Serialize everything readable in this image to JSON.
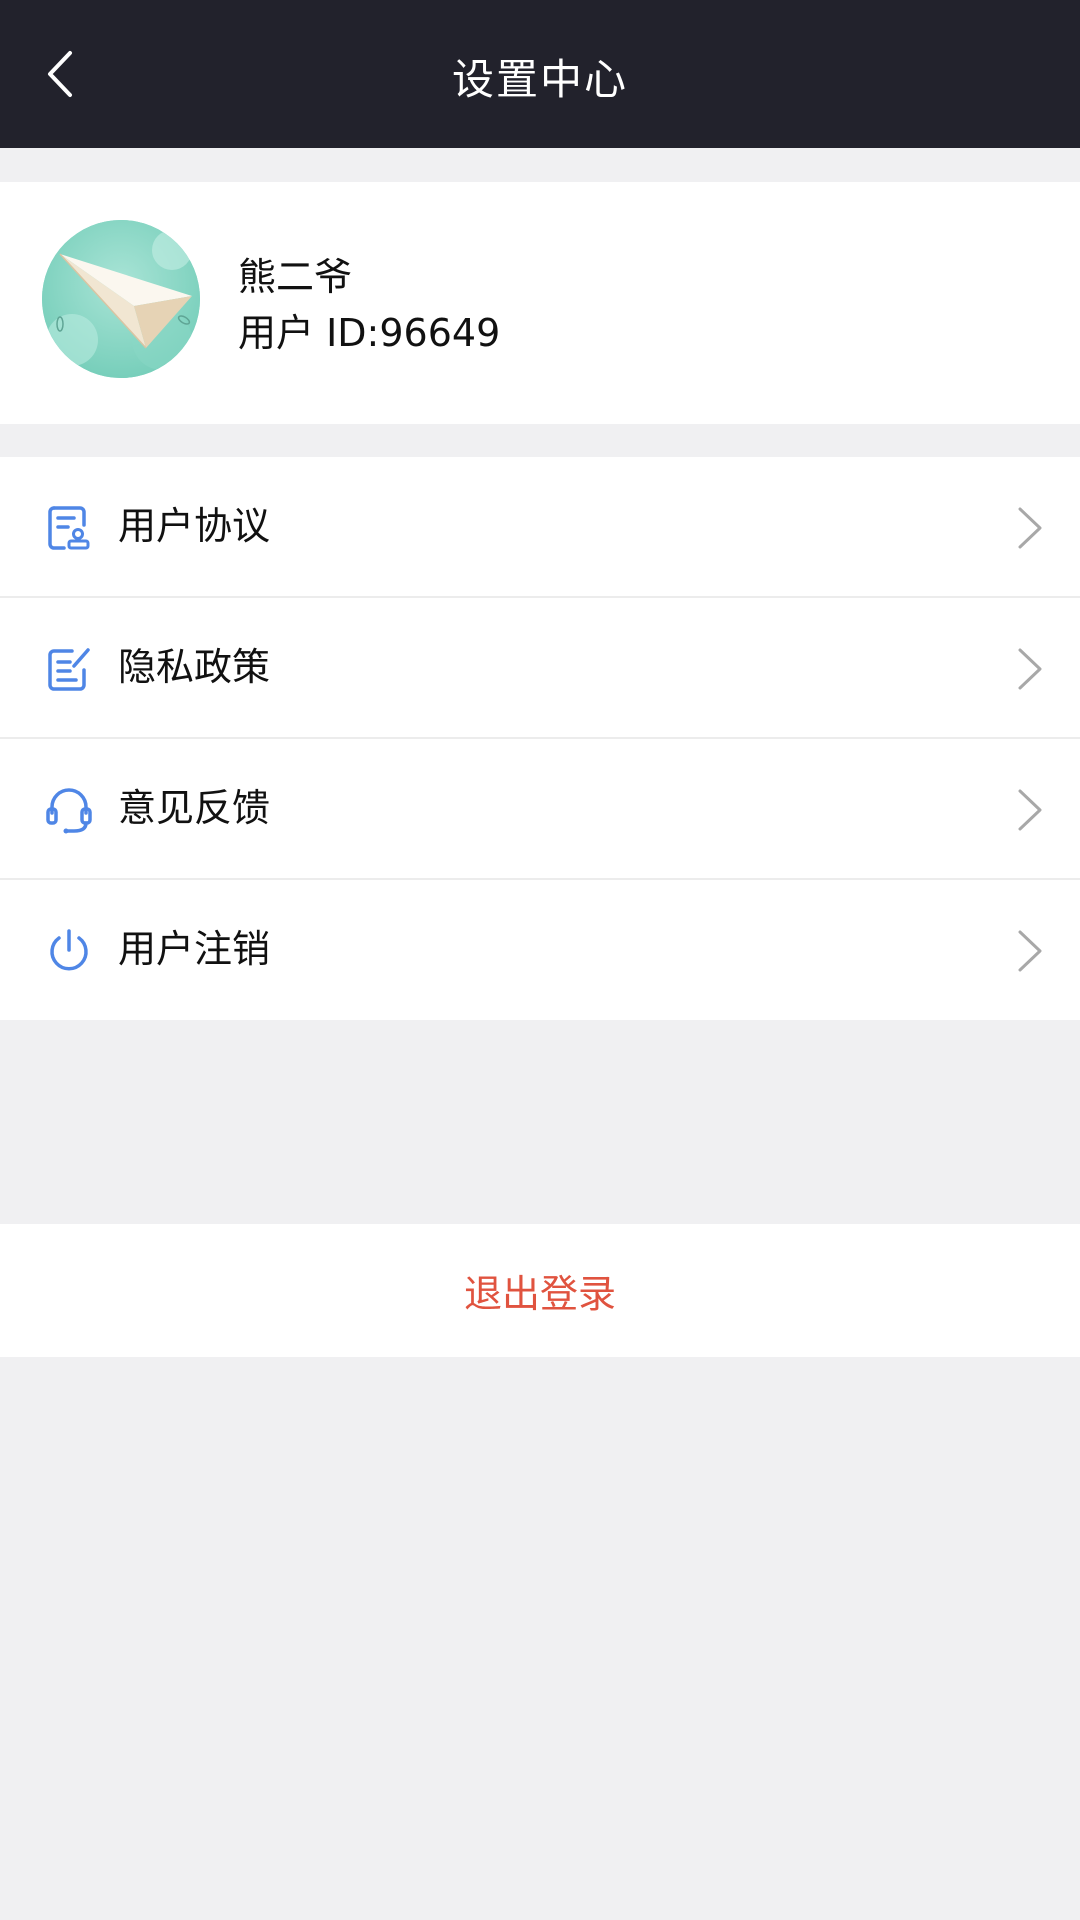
{
  "navbar": {
    "title": "设置中心",
    "back_icon": "chevron-left-icon"
  },
  "profile": {
    "name": "熊二爷",
    "id_label": "用户 ID:",
    "id_value": "96649"
  },
  "menu": {
    "items": [
      {
        "label": "用户协议",
        "icon": "agreement-document-icon"
      },
      {
        "label": "隐私政策",
        "icon": "edit-document-icon"
      },
      {
        "label": "意见反馈",
        "icon": "headset-icon"
      },
      {
        "label": "用户注销",
        "icon": "power-icon"
      }
    ]
  },
  "logout": {
    "label": "退出登录"
  },
  "colors": {
    "navbar_bg": "#22222c",
    "page_bg": "#f0f0f2",
    "icon_blue": "#4f86e6",
    "logout_red": "#e0533f"
  }
}
